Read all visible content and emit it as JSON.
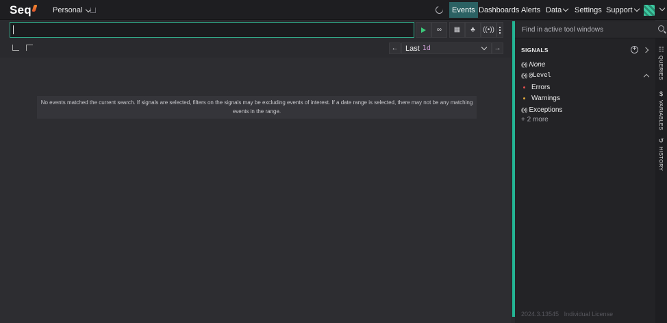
{
  "app": {
    "name": "Seq"
  },
  "topbar": {
    "workspace": "Personal",
    "nav": [
      "Events",
      "Dashboards",
      "Alerts",
      "Data",
      "Settings",
      "Support"
    ],
    "active_nav": "Events"
  },
  "search": {
    "value": ""
  },
  "range": {
    "prefix": "Last",
    "value": "1d"
  },
  "main": {
    "empty_message": "No events matched the current search. If signals are selected, filters on the signals may be excluding events of interest. If a date range is selected, there may not be any matching events in the range."
  },
  "panel": {
    "find_placeholder": "Find in active tool windows",
    "signals_title": "SIGNALS",
    "signals": [
      {
        "label": "None",
        "italic": true
      },
      {
        "label": "@Level",
        "mono": true
      },
      {
        "label": "Exceptions"
      }
    ],
    "level_items": [
      {
        "label": "Errors",
        "color": "#e04e4e"
      },
      {
        "label": "Warnings",
        "color": "#e0a83c"
      }
    ],
    "more": "+ 2 more",
    "footer_version": "2024.3.13545",
    "footer_license": "Individual License"
  },
  "side_tabs": [
    "QUERIES",
    "VARIABLES",
    "HISTORY"
  ],
  "colors": {
    "accent": "#24b493",
    "active_nav": "#2b6163"
  }
}
